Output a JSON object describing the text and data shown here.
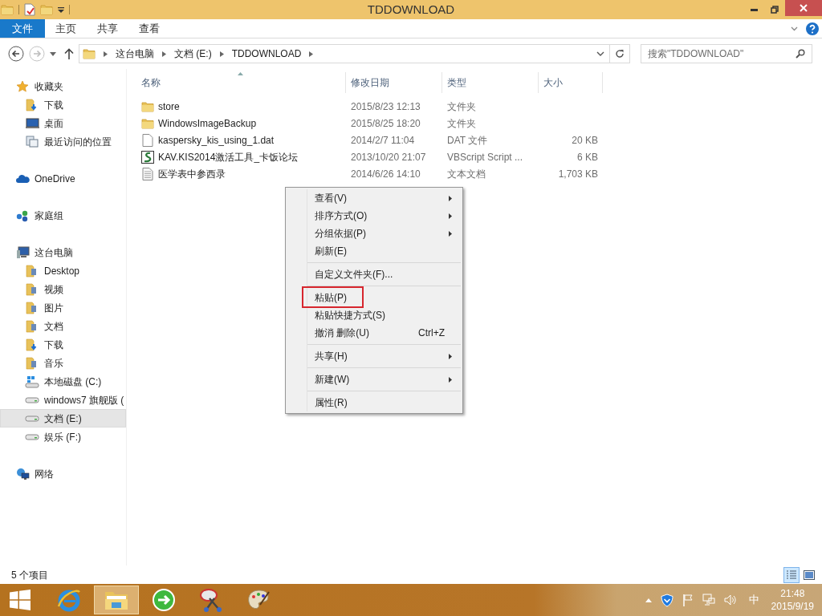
{
  "window": {
    "title": "TDDOWNLOAD"
  },
  "ribbon_tabs": [
    {
      "label": "文件",
      "kind": "file"
    },
    {
      "label": "主页",
      "kind": "tab"
    },
    {
      "label": "共享",
      "kind": "tab"
    },
    {
      "label": "查看",
      "kind": "tab"
    }
  ],
  "address": {
    "segments": [
      "这台电脑",
      "文档 (E:)",
      "TDDOWNLOAD"
    ],
    "forward_disabled": true
  },
  "search": {
    "placeholder": "搜索\"TDDOWNLOAD\""
  },
  "sidebar": {
    "groups": [
      {
        "label": "收藏夹",
        "kind": "favorites",
        "selected": false,
        "children": [
          {
            "label": "下载",
            "kind": "download",
            "selected": false
          },
          {
            "label": "桌面",
            "kind": "desktop",
            "selected": false
          },
          {
            "label": "最近访问的位置",
            "kind": "recent",
            "selected": false
          }
        ]
      },
      {
        "label": "OneDrive",
        "kind": "cloud",
        "selected": false
      },
      {
        "label": "家庭组",
        "kind": "homegroup",
        "selected": false
      },
      {
        "label": "这台电脑",
        "kind": "computer",
        "selected": false,
        "children": [
          {
            "label": "Desktop",
            "kind": "folder",
            "selected": false
          },
          {
            "label": "视频",
            "kind": "folder",
            "selected": false
          },
          {
            "label": "图片",
            "kind": "folder",
            "selected": false
          },
          {
            "label": "文档",
            "kind": "folder",
            "selected": false
          },
          {
            "label": "下载",
            "kind": "download",
            "selected": false
          },
          {
            "label": "音乐",
            "kind": "folder",
            "selected": false
          },
          {
            "label": "本地磁盘 (C:)",
            "kind": "system-drive",
            "selected": false
          },
          {
            "label": "windows7 旗舰版 (",
            "kind": "drive",
            "selected": false
          },
          {
            "label": "文档 (E:)",
            "kind": "drive",
            "selected": true
          },
          {
            "label": "娱乐 (F:)",
            "kind": "drive",
            "selected": false
          }
        ]
      },
      {
        "label": "网络",
        "kind": "network",
        "selected": false
      }
    ]
  },
  "table": {
    "columns": [
      "名称",
      "修改日期",
      "类型",
      "大小"
    ],
    "rows": [
      {
        "kind": "folder",
        "name": "store",
        "date": "2015/8/23 12:13",
        "type": "文件夹"
      },
      {
        "kind": "folder",
        "name": "WindowsImageBackup",
        "date": "2015/8/25 18:20",
        "type": "文件夹"
      },
      {
        "kind": "file",
        "name": "kaspersky_kis_using_1.dat",
        "date": "2014/2/7 11:04",
        "type": "DAT 文件",
        "size": "20 KB"
      },
      {
        "kind": "script",
        "name": "KAV.KIS2014激活工具_卡饭论坛",
        "date": "2013/10/20 21:07",
        "type": "VBScript Script ...",
        "size": "6 KB"
      },
      {
        "kind": "text",
        "name": "医学表中参西录",
        "date": "2014/6/26 14:10",
        "type": "文本文档",
        "size": "1,703 KB"
      }
    ]
  },
  "context_menu": [
    {
      "kind": "item",
      "label": "查看(V)",
      "submenu": true,
      "highlighted": false
    },
    {
      "kind": "item",
      "label": "排序方式(O)",
      "submenu": true,
      "highlighted": false
    },
    {
      "kind": "item",
      "label": "分组依据(P)",
      "submenu": true,
      "highlighted": false
    },
    {
      "kind": "item",
      "label": "刷新(E)",
      "submenu": false,
      "highlighted": false
    },
    {
      "kind": "separator"
    },
    {
      "kind": "item",
      "label": "自定义文件夹(F)...",
      "submenu": false,
      "highlighted": false
    },
    {
      "kind": "separator"
    },
    {
      "kind": "item",
      "label": "粘贴(P)",
      "submenu": false,
      "highlighted": true
    },
    {
      "kind": "item",
      "label": "粘贴快捷方式(S)",
      "submenu": false,
      "highlighted": false
    },
    {
      "kind": "item",
      "label": "撤消 删除(U)",
      "shortcut": "Ctrl+Z",
      "submenu": false,
      "highlighted": false
    },
    {
      "kind": "separator"
    },
    {
      "kind": "item",
      "label": "共享(H)",
      "submenu": true,
      "highlighted": false
    },
    {
      "kind": "separator"
    },
    {
      "kind": "item",
      "label": "新建(W)",
      "submenu": true,
      "highlighted": false
    },
    {
      "kind": "separator"
    },
    {
      "kind": "item",
      "label": "属性(R)",
      "submenu": false,
      "highlighted": false
    }
  ],
  "status_bar": {
    "item_count": "5 个项目"
  },
  "taskbar": {
    "apps": [
      {
        "kind": "ie",
        "active": false
      },
      {
        "kind": "explorer",
        "active": true
      },
      {
        "kind": "green",
        "active": false
      },
      {
        "kind": "scissors",
        "active": false
      },
      {
        "kind": "palette",
        "active": false
      }
    ],
    "ime": "中",
    "time": "21:48",
    "date": "2015/9/19"
  }
}
